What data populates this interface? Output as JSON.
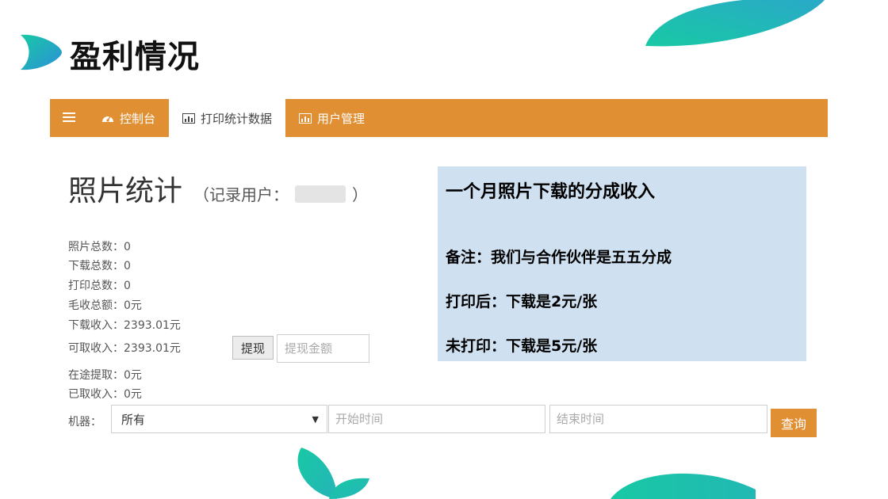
{
  "slide": {
    "title": "盈利情况"
  },
  "navbar": {
    "menu_icon": "hamburger-icon",
    "items": [
      {
        "label": "控制台",
        "icon": "dashboard-icon",
        "active": false
      },
      {
        "label": "打印统计数据",
        "icon": "bar-chart-icon",
        "active": true
      },
      {
        "label": "用户管理",
        "icon": "bar-chart-icon",
        "active": false
      }
    ]
  },
  "page": {
    "heading": "照片统计",
    "subheading_prefix": "（记录用户：",
    "subheading_suffix": "）"
  },
  "stats": [
    {
      "text": "照片总数：0"
    },
    {
      "text": "下载总数：0"
    },
    {
      "text": "打印总数：0"
    },
    {
      "text": "毛收总额：0元"
    },
    {
      "text": "下载收入：2393.01元"
    },
    {
      "text": "可取收入：2393.01元"
    },
    {
      "text": "在途提取：0元"
    },
    {
      "text": "已取收入：0元"
    }
  ],
  "withdraw": {
    "button_label": "提现",
    "amount_placeholder": "提现金额"
  },
  "filter": {
    "machine_label": "机器：",
    "machine_value": "所有",
    "start_placeholder": "开始时间",
    "end_placeholder": "结束时间",
    "query_label": "查询"
  },
  "note": {
    "title": "一个月照片下载的分成收入",
    "lines": [
      "备注：我们与合作伙伴是五五分成",
      "打印后：下载是2元/张",
      "未打印：下载是5元/张"
    ]
  },
  "colors": {
    "nav_bg": "#e08f33",
    "note_bg": "#cfe0f0",
    "leaf_teal": "#1ec9a5",
    "leaf_blue": "#2c8fd8"
  }
}
